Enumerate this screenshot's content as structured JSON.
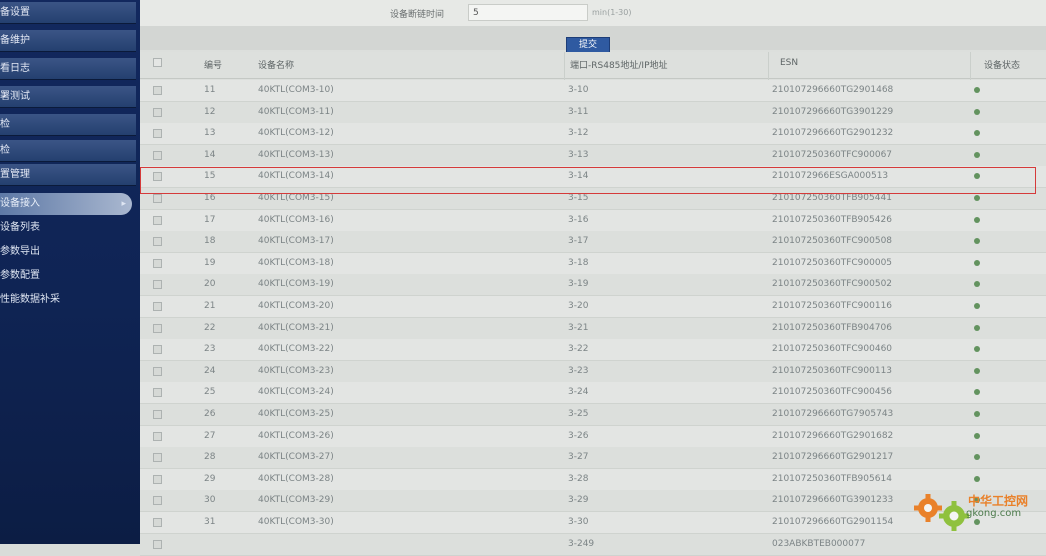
{
  "sidebar": {
    "items": [
      {
        "label": "备设置"
      },
      {
        "label": "备维护"
      },
      {
        "label": "看日志"
      },
      {
        "label": "署测试"
      },
      {
        "label": "检"
      },
      {
        "label": "检"
      },
      {
        "label": "置管理"
      }
    ],
    "subitems": [
      {
        "label": "设备接入",
        "active": true
      },
      {
        "label": "设备列表",
        "active": false
      },
      {
        "label": "参数导出",
        "active": false
      },
      {
        "label": "参数配置",
        "active": false
      },
      {
        "label": "性能数据补采",
        "active": false
      }
    ]
  },
  "form": {
    "time_label": "设备断链时间",
    "time_value": "5",
    "time_hint": "min(1-30)",
    "submit_label": "提交"
  },
  "table": {
    "columns": {
      "no": "编号",
      "name": "设备名称",
      "port": "端口-RS485地址/IP地址",
      "esn": "ESN",
      "status": "设备状态"
    },
    "rows": [
      {
        "no": "11",
        "name": "40KTL(COM3-10)",
        "port": "3-10",
        "esn": "210107296660TG2901468",
        "status": "online"
      },
      {
        "no": "12",
        "name": "40KTL(COM3-11)",
        "port": "3-11",
        "esn": "210107296660TG3901229",
        "status": "online"
      },
      {
        "no": "13",
        "name": "40KTL(COM3-12)",
        "port": "3-12",
        "esn": "210107296660TG2901232",
        "status": "online"
      },
      {
        "no": "14",
        "name": "40KTL(COM3-13)",
        "port": "3-13",
        "esn": "210107250360TFC900067",
        "status": "online"
      },
      {
        "no": "15",
        "name": "40KTL(COM3-14)",
        "port": "3-14",
        "esn": "2101072966ESGA000513",
        "status": "online"
      },
      {
        "no": "16",
        "name": "40KTL(COM3-15)",
        "port": "3-15",
        "esn": "210107250360TFB905441",
        "status": "online"
      },
      {
        "no": "17",
        "name": "40KTL(COM3-16)",
        "port": "3-16",
        "esn": "210107250360TFB905426",
        "status": "online"
      },
      {
        "no": "18",
        "name": "40KTL(COM3-17)",
        "port": "3-17",
        "esn": "210107250360TFC900508",
        "status": "online"
      },
      {
        "no": "19",
        "name": "40KTL(COM3-18)",
        "port": "3-18",
        "esn": "210107250360TFC900005",
        "status": "online"
      },
      {
        "no": "20",
        "name": "40KTL(COM3-19)",
        "port": "3-19",
        "esn": "210107250360TFC900502",
        "status": "online"
      },
      {
        "no": "21",
        "name": "40KTL(COM3-20)",
        "port": "3-20",
        "esn": "210107250360TFC900116",
        "status": "online"
      },
      {
        "no": "22",
        "name": "40KTL(COM3-21)",
        "port": "3-21",
        "esn": "210107250360TFB904706",
        "status": "online"
      },
      {
        "no": "23",
        "name": "40KTL(COM3-22)",
        "port": "3-22",
        "esn": "210107250360TFC900460",
        "status": "online"
      },
      {
        "no": "24",
        "name": "40KTL(COM3-23)",
        "port": "3-23",
        "esn": "210107250360TFC900113",
        "status": "online"
      },
      {
        "no": "25",
        "name": "40KTL(COM3-24)",
        "port": "3-24",
        "esn": "210107250360TFC900456",
        "status": "online"
      },
      {
        "no": "26",
        "name": "40KTL(COM3-25)",
        "port": "3-25",
        "esn": "210107296660TG7905743",
        "status": "online"
      },
      {
        "no": "27",
        "name": "40KTL(COM3-26)",
        "port": "3-26",
        "esn": "210107296660TG2901682",
        "status": "online"
      },
      {
        "no": "28",
        "name": "40KTL(COM3-27)",
        "port": "3-27",
        "esn": "210107296660TG2901217",
        "status": "online"
      },
      {
        "no": "29",
        "name": "40KTL(COM3-28)",
        "port": "3-28",
        "esn": "210107250360TFB905614",
        "status": "online"
      },
      {
        "no": "30",
        "name": "40KTL(COM3-29)",
        "port": "3-29",
        "esn": "210107296660TG3901233",
        "status": "online"
      },
      {
        "no": "31",
        "name": "40KTL(COM3-30)",
        "port": "3-30",
        "esn": "210107296660TG2901154",
        "status": "online"
      },
      {
        "no": "",
        "name": "",
        "port": "3-249",
        "esn": "023ABKBTEB000077",
        "status": ""
      }
    ],
    "highlight_row": "15"
  },
  "watermark": {
    "title": "中华工控网",
    "url": "gkong.com"
  },
  "colors": {
    "sidebar": "#12285e",
    "submit_button": "#2f5aa1",
    "status_online": "#63935f",
    "highlight_border": "#d53a3a",
    "watermark_orange": "#e9812a",
    "watermark_green": "#8fc13e"
  }
}
